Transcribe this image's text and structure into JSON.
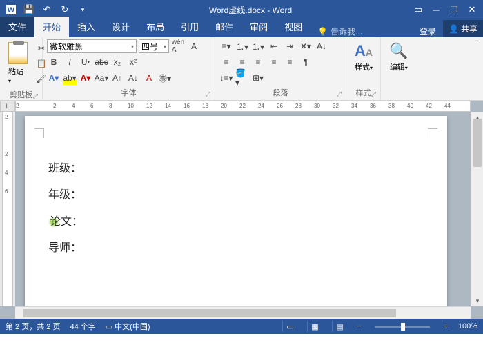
{
  "titlebar": {
    "title": "Word虚线.docx - Word"
  },
  "menu": {
    "file": "文件",
    "home": "开始",
    "insert": "插入",
    "design": "设计",
    "layout": "布局",
    "references": "引用",
    "mail": "邮件",
    "review": "审阅",
    "view": "视图",
    "tell": "告诉我...",
    "login": "登录",
    "share": "共享"
  },
  "ribbon": {
    "clipboard": {
      "paste": "粘贴",
      "label": "剪贴板"
    },
    "font": {
      "name": "微软雅黑",
      "size": "四号",
      "label": "字体"
    },
    "paragraph": {
      "label": "段落"
    },
    "styles": {
      "btn": "样式",
      "label": "样式"
    },
    "editing": {
      "btn": "编辑"
    }
  },
  "document": {
    "lines": [
      "班级：",
      "年级：",
      "论文：",
      "导师："
    ]
  },
  "ruler_h": [
    "2",
    "",
    "2",
    "4",
    "6",
    "8",
    "10",
    "12",
    "14",
    "16",
    "18",
    "20",
    "22",
    "24",
    "26",
    "28",
    "30",
    "32",
    "34",
    "36",
    "38",
    "40",
    "42",
    "44"
  ],
  "ruler_v": [
    "2",
    "",
    "2",
    "4",
    "6"
  ],
  "statusbar": {
    "page": "第 2 页，共 2 页",
    "words": "44 个字",
    "lang": "中文(中国)",
    "zoom": "100%"
  }
}
